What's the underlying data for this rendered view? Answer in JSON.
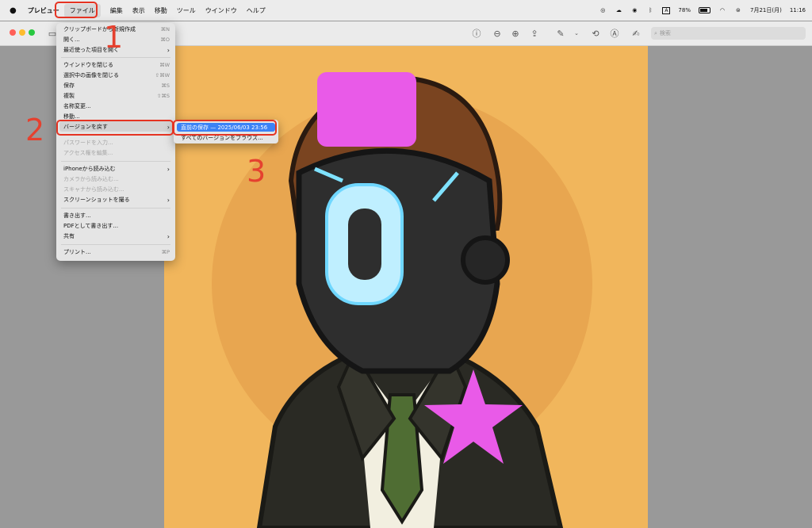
{
  "menubar": {
    "app_name": "プレビュー",
    "items": [
      "ファイル",
      "編集",
      "表示",
      "移動",
      "ツール",
      "ウインドウ",
      "ヘルプ"
    ],
    "battery": "78%",
    "date": "7月21日(月)",
    "time": "11:16",
    "input_label": "A"
  },
  "toolbar": {
    "search_placeholder": "検索"
  },
  "file_menu": {
    "items": [
      {
        "label": "クリップボードから新規作成",
        "shortcut": "⌘N"
      },
      {
        "label": "開く...",
        "shortcut": "⌘O"
      },
      {
        "label": "最近使った項目を開く",
        "shortcut": ""
      },
      {
        "label": "ウインドウを閉じる",
        "shortcut": "⌘W"
      },
      {
        "label": "選択中の画像を閉じる",
        "shortcut": "⇧⌘W"
      },
      {
        "label": "保存",
        "shortcut": "⌘S"
      },
      {
        "label": "複製",
        "shortcut": "⇧⌘S"
      },
      {
        "label": "名称変更...",
        "shortcut": ""
      },
      {
        "label": "移動...",
        "shortcut": ""
      },
      {
        "label": "バージョンを戻す",
        "shortcut": ""
      },
      {
        "label": "パスワードを入力...",
        "shortcut": ""
      },
      {
        "label": "アクセス権を編集...",
        "shortcut": ""
      },
      {
        "label": "iPhoneから読み込む",
        "shortcut": ""
      },
      {
        "label": "カメラから読み込む...",
        "shortcut": ""
      },
      {
        "label": "スキャナから読み込む...",
        "shortcut": ""
      },
      {
        "label": "スクリーンショットを撮る",
        "shortcut": ""
      },
      {
        "label": "書き出す...",
        "shortcut": ""
      },
      {
        "label": "PDFとして書き出す...",
        "shortcut": ""
      },
      {
        "label": "共有",
        "shortcut": ""
      },
      {
        "label": "プリント...",
        "shortcut": "⌘P"
      }
    ]
  },
  "version_submenu": {
    "items": [
      "直前の保存 — 2025/06/03 23:56",
      "すべてのバージョンをブラウズ..."
    ]
  },
  "annotations": {
    "steps": [
      "1",
      "2",
      "3"
    ]
  },
  "icons": [
    "apple-icon",
    "sidebar-icon",
    "info-icon",
    "zoom-out-icon",
    "zoom-in-icon",
    "share-icon",
    "markup-pen-icon",
    "rotate-icon",
    "highlight-icon",
    "sign-icon",
    "search-icon",
    "wifi-icon",
    "bluetooth-icon",
    "battery-icon"
  ]
}
